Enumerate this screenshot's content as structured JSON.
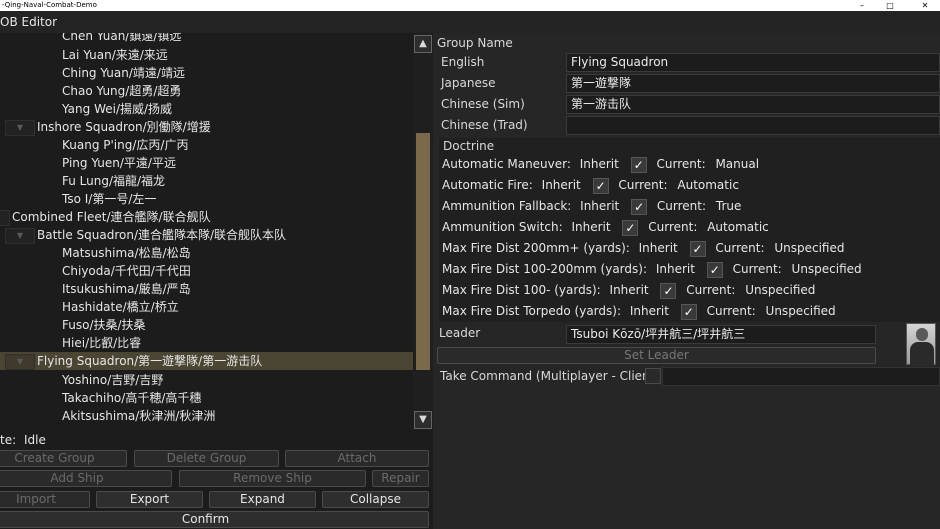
{
  "window": {
    "title": "-Qing-Naval-Combat-Demo",
    "min": "–",
    "max": "□",
    "close": "✕"
  },
  "menu": {
    "title": "OB Editor"
  },
  "tree": {
    "toggle_glyph": "▼",
    "rows": [
      {
        "label": "Chen Yuan/鎮遠/镇远"
      },
      {
        "label": "Lai Yuan/来遠/来远"
      },
      {
        "label": "Ching Yuan/靖遠/靖远"
      },
      {
        "label": "Chao Yung/超勇/超勇"
      },
      {
        "label": "Yang Wei/揚威/扬威"
      },
      {
        "label": "Inshore Squadron/別働隊/增援"
      },
      {
        "label": "Kuang P'ing/広丙/广丙"
      },
      {
        "label": "Ping Yuen/平遠/平远"
      },
      {
        "label": "Fu Lung/福龍/福龙"
      },
      {
        "label": "Tso I/第一号/左一"
      },
      {
        "label": "Combined Fleet/連合艦隊/联合舰队"
      },
      {
        "label": "Battle Squadron/連合艦隊本隊/联合舰队本队"
      },
      {
        "label": "Matsushima/松島/松岛"
      },
      {
        "label": "Chiyoda/千代田/千代田"
      },
      {
        "label": "Itsukushima/厳島/严岛"
      },
      {
        "label": "Hashidate/橋立/桥立"
      },
      {
        "label": "Fuso/扶桑/扶桑"
      },
      {
        "label": "Hiei/比叡/比睿"
      },
      {
        "label": "Flying Squadron/第一遊撃隊/第一游击队"
      },
      {
        "label": "Yoshino/吉野/吉野"
      },
      {
        "label": "Takachiho/高千穂/高千穗"
      },
      {
        "label": "Akitsushima/秋津洲/秋津洲"
      }
    ]
  },
  "scroll": {
    "up": "▲",
    "down": "▼"
  },
  "state": {
    "label": "te:",
    "value": "Idle"
  },
  "buttons": {
    "create_group": "Create Group",
    "delete_group": "Delete Group",
    "attach": "Attach",
    "add_ship": "Add Ship",
    "remove_ship": "Remove Ship",
    "repair": "Repair",
    "import": "Import",
    "export": "Export",
    "expand": "Expand",
    "collapse": "Collapse",
    "confirm": "Confirm"
  },
  "group": {
    "heading": "Group Name",
    "english_label": "English",
    "english_value": "Flying Squadron",
    "japanese_label": "Japanese",
    "japanese_value": "第一遊撃隊",
    "chinese_sim_label": "Chinese (Sim)",
    "chinese_sim_value": "第一游击队",
    "chinese_trad_label": "Chinese (Trad)",
    "chinese_trad_value": ""
  },
  "doctrine": {
    "heading": "Doctrine",
    "inherit_label": "Inherit",
    "current_label": "Current:",
    "check_glyph": "✓",
    "rows": [
      {
        "name": "Automatic Maneuver:",
        "inherit": true,
        "current": "Manual"
      },
      {
        "name": "Automatic Fire:",
        "inherit": true,
        "current": "Automatic"
      },
      {
        "name": "Ammunition Fallback:",
        "inherit": true,
        "current": "True"
      },
      {
        "name": "Ammunition Switch:",
        "inherit": true,
        "current": "Automatic"
      },
      {
        "name": "Max Fire Dist 200mm+ (yards):",
        "inherit": true,
        "current": "Unspecified"
      },
      {
        "name": "Max Fire Dist 100-200mm (yards):",
        "inherit": true,
        "current": "Unspecified"
      },
      {
        "name": "Max Fire Dist 100- (yards):",
        "inherit": true,
        "current": "Unspecified"
      },
      {
        "name": "Max Fire Dist Torpedo (yards):",
        "inherit": true,
        "current": "Unspecified"
      }
    ]
  },
  "leader": {
    "label": "Leader",
    "value": "Tsuboi Kōzō/坪井航三/坪井航三",
    "set_button": "Set Leader",
    "take_command_label": "Take Command (Multiplayer - Client)",
    "take_command_checked": false
  }
}
